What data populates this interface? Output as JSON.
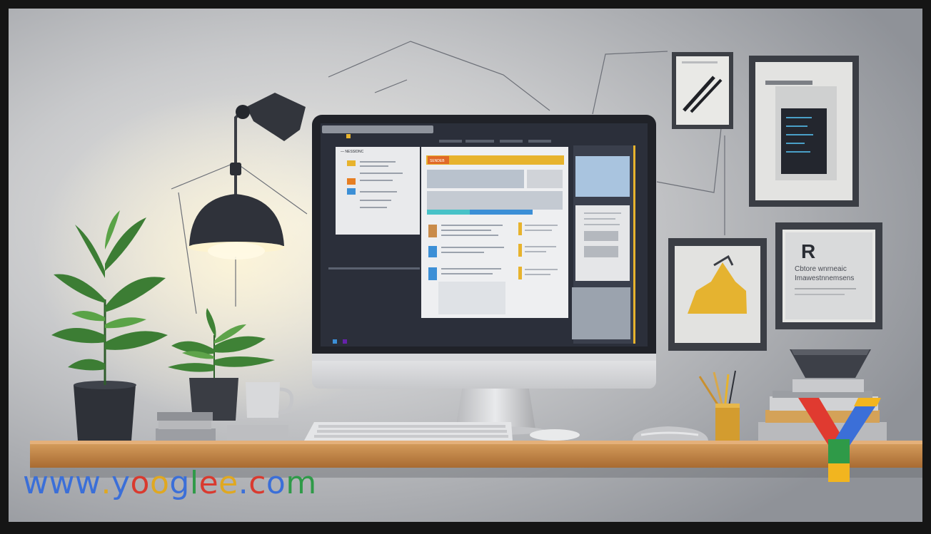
{
  "watermark": {
    "text": "www.yooglee.com",
    "letter_colors": [
      "#3b6fd8",
      "#3b6fd8",
      "#3b6fd8",
      "#e0a820",
      "#3b6fd8",
      "#d93a2f",
      "#e0a820",
      "#3b6fd8",
      "#2f9a48",
      "#d93a2f",
      "#e0a820",
      "#3b6fd8",
      "#d93a2f",
      "#3b6fd8",
      "#2f9a48"
    ]
  },
  "logo": {
    "glyph": "Y",
    "colors": [
      "#e03a30",
      "#3b6fd8",
      "#f2b51f",
      "#2f9a48"
    ]
  },
  "framed_art": {
    "r_card_letter": "R",
    "r_card_line_1": "Cbtore wnrneaic",
    "r_card_line_2": "Imawestnnemsens"
  },
  "screen": {
    "tab_badge_text": "SENDEB",
    "left_panel_header": "— NESSIDNC"
  },
  "colors": {
    "wall": "#c9cacd",
    "shelf": "#c98b4a",
    "screen_bg": "#2b2f3a",
    "accent_yellow": "#e7b32d",
    "accent_blue": "#3c8fd6"
  }
}
